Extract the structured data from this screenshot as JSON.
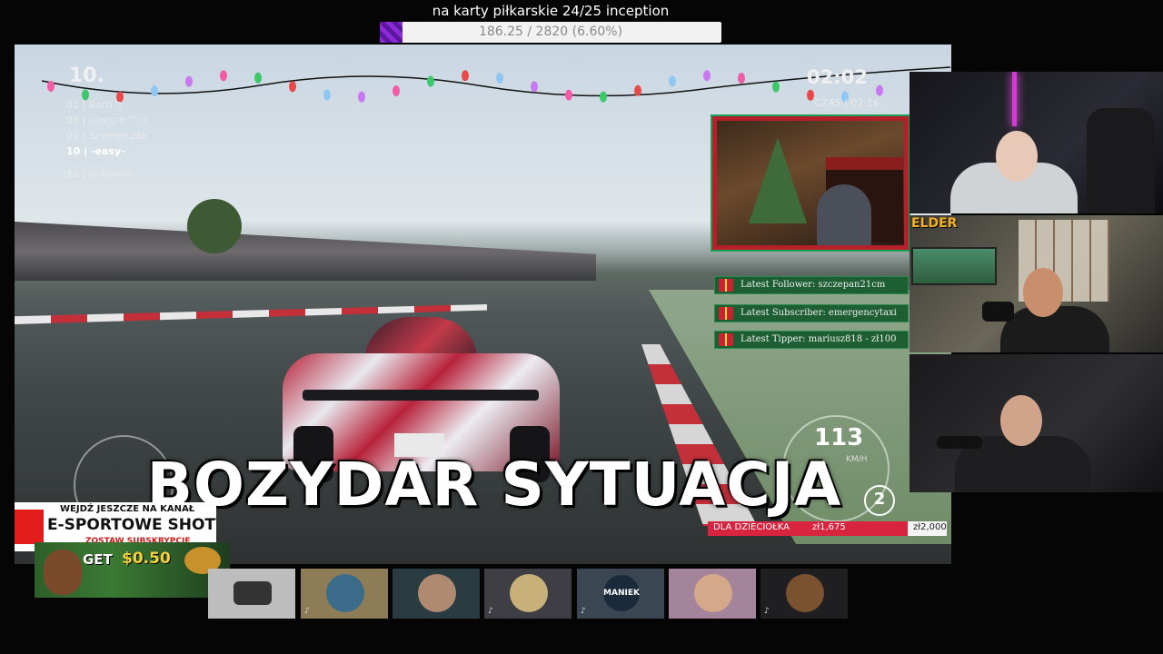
{
  "goal": {
    "title": "na karty piłkarskie 24/25 inception",
    "progress_text": "186.25 / 2820 (6.60%)",
    "progress_fraction": 0.066,
    "fill_color": "#8a2bd6"
  },
  "game": {
    "position_big": "10.",
    "leaderboard": [
      {
        "text": "01 | Barti ▯",
        "me": false
      },
      {
        "text": "08 | ▯▯o▯▯®™ :]",
        "me": false
      },
      {
        "text": "09 | Szymelczak",
        "me": false
      },
      {
        "text": "10 | -easy-",
        "me": true
      },
      {
        "text": "11 | G-Alienn",
        "me": false
      }
    ],
    "time_big": "02:02",
    "time_label": "CZAS | 02:16.",
    "speed": "113",
    "speed_unit": "KM/H",
    "gear": "2",
    "caption": "BOZYDAR SYTUACJA"
  },
  "donation": {
    "label": "DLA DZIECIOŁKA",
    "current": "zł1,675",
    "goal": "zł2,000",
    "fraction": 0.8375
  },
  "alerts": [
    {
      "text": "Latest Follower: szczepan21cm"
    },
    {
      "text": "Latest Subscriber: emergencytaxi"
    },
    {
      "text": "Latest Tipper: mariusz818 - zł100"
    }
  ],
  "cams": {
    "elder_logo": "ELDER"
  },
  "promo": {
    "line1": "WEJDŹ JESZCZE NA KANAŁ",
    "line2": "E-SPORTOWE SHOTY",
    "line3": "ZOSTAW SUBSKRYPCJE"
  },
  "ad": {
    "get": "GET",
    "amount": "$0.50"
  },
  "strip": {
    "maniek": "MANIEK"
  }
}
